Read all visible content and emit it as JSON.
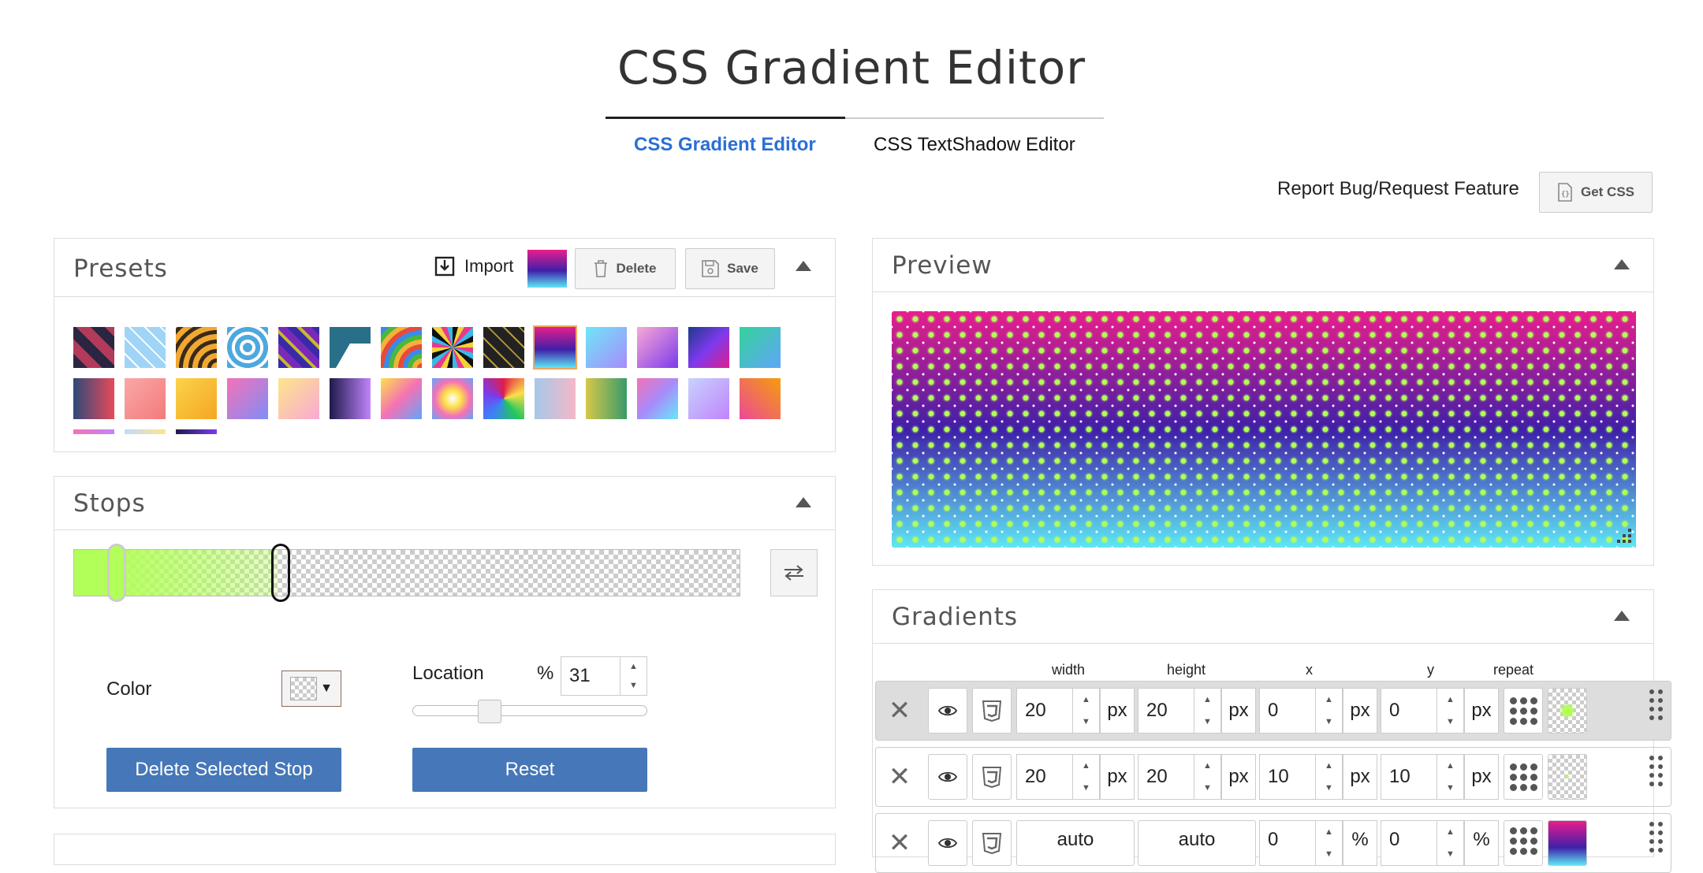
{
  "app": {
    "title": "CSS Gradient Editor"
  },
  "tabs": [
    {
      "label": "CSS Gradient Editor",
      "active": true
    },
    {
      "label": "CSS TextShadow Editor",
      "active": false
    }
  ],
  "header": {
    "report_link": "Report Bug/Request Feature",
    "get_css": "Get CSS"
  },
  "presets": {
    "title": "Presets",
    "import_label": "Import",
    "delete_label": "Delete",
    "save_label": "Save"
  },
  "stops": {
    "title": "Stops",
    "color_label": "Color",
    "location_label": "Location",
    "percent_sign": "%",
    "location_value": "31",
    "location_percent": 31,
    "delete_button": "Delete Selected Stop",
    "reset_button": "Reset"
  },
  "preview": {
    "title": "Preview"
  },
  "gradients": {
    "title": "Gradients",
    "columns": [
      "width",
      "height",
      "x",
      "y",
      "repeat"
    ],
    "rows": [
      {
        "width": "20",
        "width_unit": "px",
        "height": "20",
        "height_unit": "px",
        "x": "0",
        "x_unit": "px",
        "y": "0",
        "y_unit": "px"
      },
      {
        "width": "20",
        "width_unit": "px",
        "height": "20",
        "height_unit": "px",
        "x": "10",
        "x_unit": "px",
        "y": "10",
        "y_unit": "px"
      },
      {
        "width": "auto",
        "height": "auto",
        "x": "0",
        "x_unit": "%",
        "y": "0",
        "y_unit": "%"
      }
    ]
  },
  "colors": {
    "accent": "#2a6fd6",
    "button": "#4677b8",
    "stop_green": "#b2ff59"
  },
  "icons": {
    "close": "close-icon",
    "eye": "eye-icon",
    "css3": "css3-icon",
    "collapse": "caret-up-icon",
    "swap": "swap-icon"
  }
}
